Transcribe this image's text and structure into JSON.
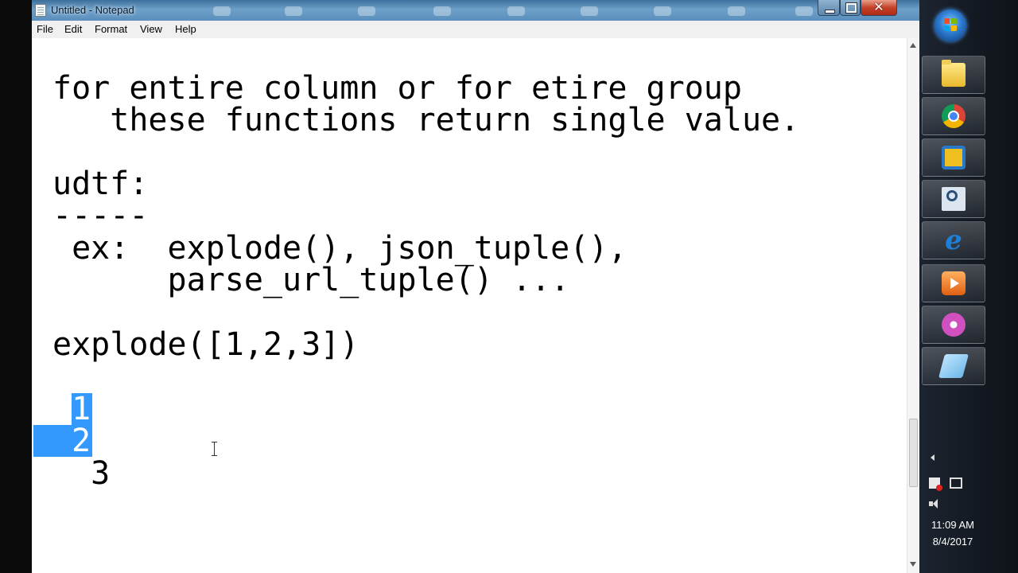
{
  "window": {
    "title": "Untitled - Notepad",
    "close_glyph": "✕"
  },
  "menu": {
    "items": [
      "File",
      "Edit",
      "Format",
      "View",
      "Help"
    ]
  },
  "editor": {
    "lines": [
      "for entire column or for etire group",
      "   these functions return single value.",
      "",
      "udtf:",
      "-----",
      " ex:  explode(), json_tuple(),",
      "      parse_url_tuple() ...",
      "",
      "explode([1,2,3])",
      "",
      "",
      "  1",
      "  2",
      "  3"
    ],
    "selected_text": [
      "1",
      "2"
    ],
    "selection_color": "#3399ff"
  },
  "taskbar": {
    "pinned": [
      {
        "name": "folder-icon"
      },
      {
        "name": "chrome-icon"
      },
      {
        "name": "virtualbox-icon"
      },
      {
        "name": "search-icon"
      },
      {
        "name": "internet-explorer-icon",
        "glyph": "e"
      },
      {
        "name": "media-player-icon"
      },
      {
        "name": "flower-app-icon"
      },
      {
        "name": "eraser-app-icon"
      }
    ],
    "clock": {
      "time": "11:09 AM",
      "date": "8/4/2017"
    }
  }
}
